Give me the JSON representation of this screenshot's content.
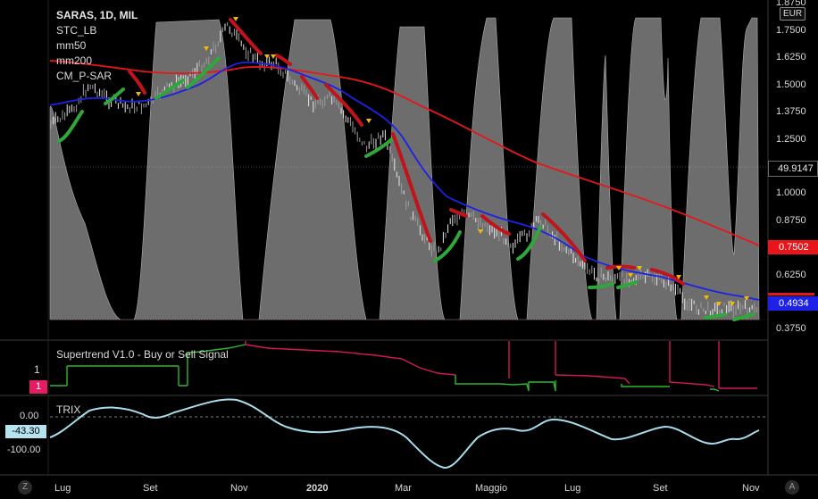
{
  "chart_title": "SARAS, 1D, MIL",
  "indicators": [
    "STC_LB",
    "mm50",
    "mm200",
    "CM_P-SAR"
  ],
  "currency_button": "EUR",
  "price_axis": {
    "ticks": [
      "1.8750",
      "1.7500",
      "1.6250",
      "1.5000",
      "1.3750",
      "1.2500",
      "1.0000",
      "0.8750",
      "0.6250",
      "0.3750"
    ],
    "marker_stc": "49.9147",
    "marker_mm200": "0.7502",
    "marker_mm50": "0.4934"
  },
  "supertrend_panel": {
    "title": "Supertrend V1.0 - Buy or Sell Signal",
    "tick": "1",
    "badge": "1"
  },
  "trix_panel": {
    "title": "TRIX",
    "tick_zero": "0.00",
    "tick_minus100": "-100.00",
    "value_badge": "-43.30"
  },
  "time_axis": [
    "Lug",
    "Set",
    "Nov",
    "2020",
    "Mar",
    "Maggio",
    "Lug",
    "Set",
    "Nov"
  ],
  "corner_buttons": {
    "left": "Z",
    "right": "A"
  },
  "colors": {
    "background": "#000000",
    "stc_fill": "#8c8c8c",
    "mm50": "#1e22e6",
    "mm200": "#e8161b",
    "psar_up": "#2fa83a",
    "psar_down": "#c0131b",
    "supertrend_up": "#2fb72f",
    "supertrend_down": "#d1185c",
    "trix": "#a8dcec",
    "signal_marker": "#f2b90d"
  },
  "chart_data": {
    "type": "line",
    "x_labels": [
      "Lug",
      "Set",
      "Nov",
      "2020",
      "Mar",
      "Maggio",
      "Lug",
      "Set",
      "Nov"
    ],
    "price_ylim": [
      0.375,
      1.875
    ],
    "series": [
      {
        "name": "mm200",
        "values": [
          1.55,
          1.56,
          1.58,
          1.59,
          1.58,
          1.52,
          1.4,
          1.27,
          1.16,
          1.06,
          0.96,
          0.87,
          0.79,
          0.75
        ]
      },
      {
        "name": "mm50",
        "values": [
          1.37,
          1.4,
          1.47,
          1.63,
          1.55,
          1.5,
          1.38,
          1.2,
          0.96,
          0.85,
          0.78,
          0.68,
          0.56,
          0.49
        ]
      },
      {
        "name": "STC_LB",
        "last": 49.9147
      },
      {
        "name": "TRIX",
        "last": -43.3
      }
    ],
    "last_values": {
      "STC_LB": 49.9147,
      "mm200": 0.7502,
      "mm50": 0.4934,
      "TRIX": -43.3
    }
  }
}
